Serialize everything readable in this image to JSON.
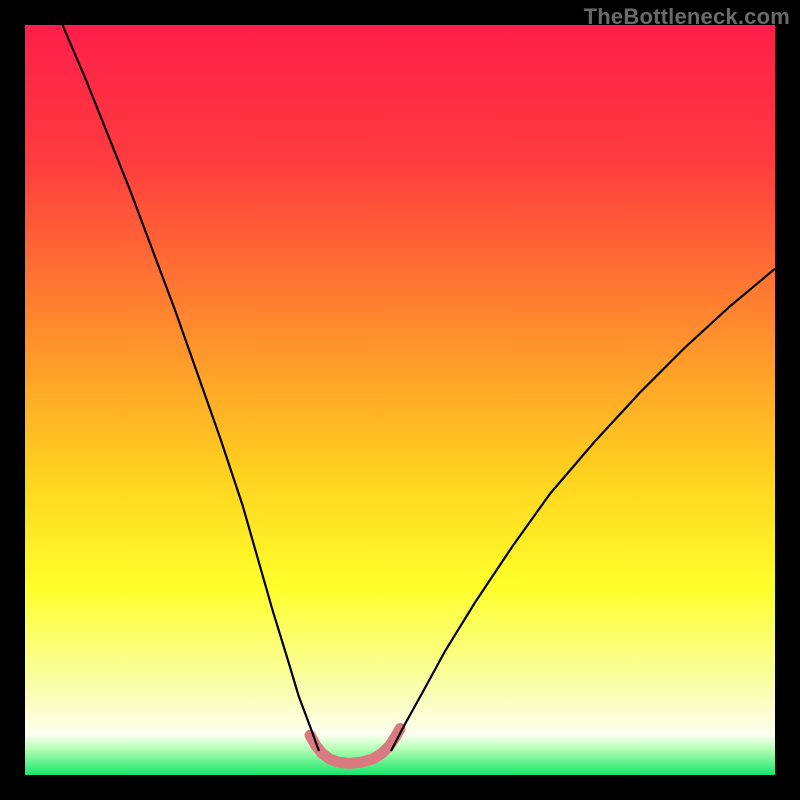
{
  "watermark": "TheBottleneck.com",
  "chart_data": {
    "type": "line",
    "title": "",
    "xlabel": "",
    "ylabel": "",
    "xlim": [
      0,
      100
    ],
    "ylim": [
      0,
      100
    ],
    "gradient_stops": [
      {
        "offset": 0.0,
        "color": "#ff1f4a"
      },
      {
        "offset": 0.18,
        "color": "#ff3b3f"
      },
      {
        "offset": 0.4,
        "color": "#ff8a2e"
      },
      {
        "offset": 0.6,
        "color": "#ffd21f"
      },
      {
        "offset": 0.75,
        "color": "#ffff2b"
      },
      {
        "offset": 0.88,
        "color": "#f8ffa8"
      },
      {
        "offset": 0.945,
        "color": "#fdfff0"
      },
      {
        "offset": 0.965,
        "color": "#b7ffb8"
      },
      {
        "offset": 1.0,
        "color": "#16e66a"
      }
    ],
    "series": [
      {
        "name": "left-curve",
        "color": "#000000",
        "width": 2.2,
        "x": [
          5,
          8,
          11,
          14,
          17,
          20,
          23,
          26,
          29,
          31,
          33,
          35,
          36.5,
          38,
          39.2
        ],
        "y": [
          100,
          93,
          85.5,
          78,
          70,
          62,
          53.5,
          45,
          36,
          29,
          22,
          15.5,
          10.5,
          6.5,
          3.2
        ]
      },
      {
        "name": "right-curve",
        "color": "#000000",
        "width": 2.2,
        "x": [
          48.8,
          50.5,
          53,
          56,
          60,
          65,
          70,
          76,
          82,
          88,
          94,
          100
        ],
        "y": [
          3.2,
          6.5,
          11,
          16.5,
          23,
          30.5,
          37.5,
          44.5,
          51,
          57,
          62.5,
          67.5
        ]
      },
      {
        "name": "valley-highlight",
        "color": "#d97a80",
        "width": 11,
        "linecap": "round",
        "x": [
          38.0,
          38.8,
          39.6,
          40.6,
          41.8,
          43.2,
          44.8,
          46.4,
          47.6,
          48.6,
          49.4,
          50.0
        ],
        "y": [
          5.3,
          3.9,
          2.9,
          2.15,
          1.7,
          1.55,
          1.7,
          2.15,
          2.9,
          3.9,
          5.1,
          6.2
        ]
      }
    ]
  }
}
